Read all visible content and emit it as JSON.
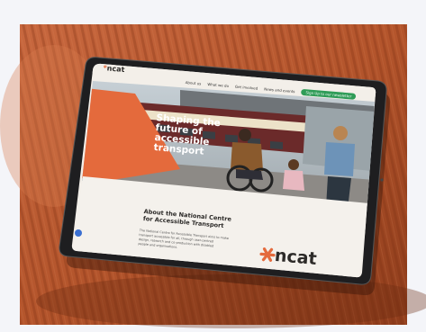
{
  "site": {
    "logo_text": "ncat",
    "nav": [
      "About us",
      "What we do",
      "Get involved",
      "News and events"
    ],
    "cta_label": "Sign Up to our newsletter",
    "hero_title_lines": [
      "Shaping the",
      "future of",
      "accessible",
      "transport"
    ],
    "about_heading_lines": [
      "About the National Centre",
      "for Accessible Transport"
    ],
    "about_body_lines": [
      "The National Centre for Accessible Transport aims to make",
      "transport accessible for all, through user-centred",
      "design, research and co-production with disabled",
      "people and organisations."
    ],
    "footer_logo": "ncat"
  },
  "colors": {
    "page_bg": "#f4f5f9",
    "fabric": "#b5542b",
    "brand_orange": "#e46a3c",
    "brand_dark": "#2c2a28",
    "cta_green": "#2f9c57",
    "screen_bg": "#f3efe9"
  }
}
